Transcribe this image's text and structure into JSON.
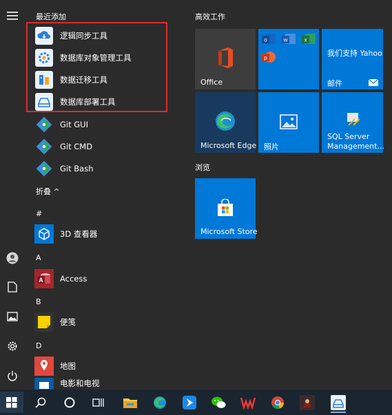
{
  "recent": {
    "title": "最近添加",
    "items": [
      "逻辑同步工具",
      "数据库对象管理工具",
      "数据迁移工具",
      "数据库部署工具"
    ]
  },
  "apps": {
    "git_gui": "Git GUI",
    "git_cmd": "Git CMD",
    "git_bash": "Git Bash",
    "collapse": "折叠 ^",
    "hash": "#",
    "viewer_3d": "3D 查看器",
    "letter_a": "A",
    "access": "Access",
    "letter_b": "B",
    "sticky": "便笺",
    "letter_d": "D",
    "maps": "地图",
    "movies": "电影和电视"
  },
  "tiles": {
    "group_productivity": "高效工作",
    "office": "Office",
    "yahoo": "我们支持 Yahoo",
    "mail": "邮件",
    "edge": "Microsoft Edge",
    "photos": "照片",
    "ssms_line1": "SQL Server",
    "ssms_line2": "Management...",
    "group_browse": "浏览",
    "store": "Microsoft Store"
  },
  "colors": {
    "tile_blue": "#0078d7",
    "tile_dark": "#3d3d3d",
    "edge_tile": "#183a5e",
    "highlight_red": "#e02b2b",
    "taskbar": "#1a2530"
  }
}
